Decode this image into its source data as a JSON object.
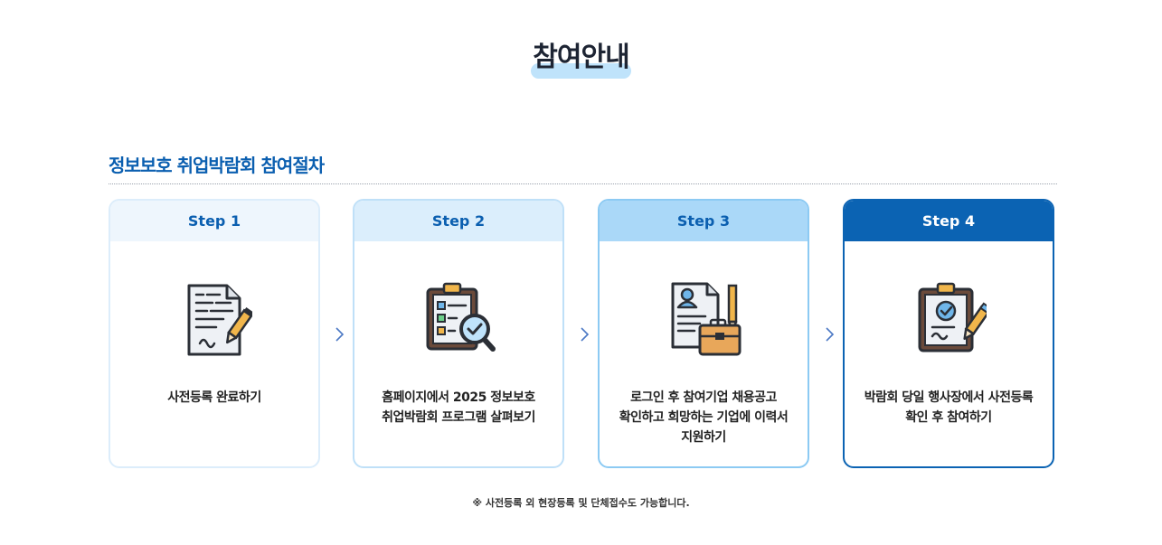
{
  "header": {
    "title": "참여안내"
  },
  "section": {
    "title": "정보보호 취업박람회 참여절차"
  },
  "steps": [
    {
      "label": "Step 1",
      "icon": "document-pen-icon",
      "lines": [
        "사전등록 완료하기"
      ]
    },
    {
      "label": "Step 2",
      "icon": "clipboard-search-icon",
      "lines": [
        "홈페이지에서 2025 정보보호",
        "취업박람회 프로그램 살펴보기"
      ]
    },
    {
      "label": "Step 3",
      "icon": "resume-briefcase-icon",
      "lines": [
        "로그인 후 참여기업 채용공고",
        "확인하고 희망하는 기업에 이력서",
        "지원하기"
      ]
    },
    {
      "label": "Step 4",
      "icon": "clipboard-check-pen-icon",
      "lines": [
        "박람회 당일 행사장에서 사전등록",
        "확인 후 참여하기"
      ]
    }
  ],
  "footer": {
    "note": "※ 사전등록 외 현장등록 및 단체접수도 가능합니다."
  },
  "colors": {
    "title_highlight": "#bfe3fb",
    "accent": "#0b63b3",
    "step1_head": "#eef6fd",
    "step2_head": "#dbeefc",
    "step3_head": "#aad8f8",
    "step4_head": "#0b63b3"
  }
}
